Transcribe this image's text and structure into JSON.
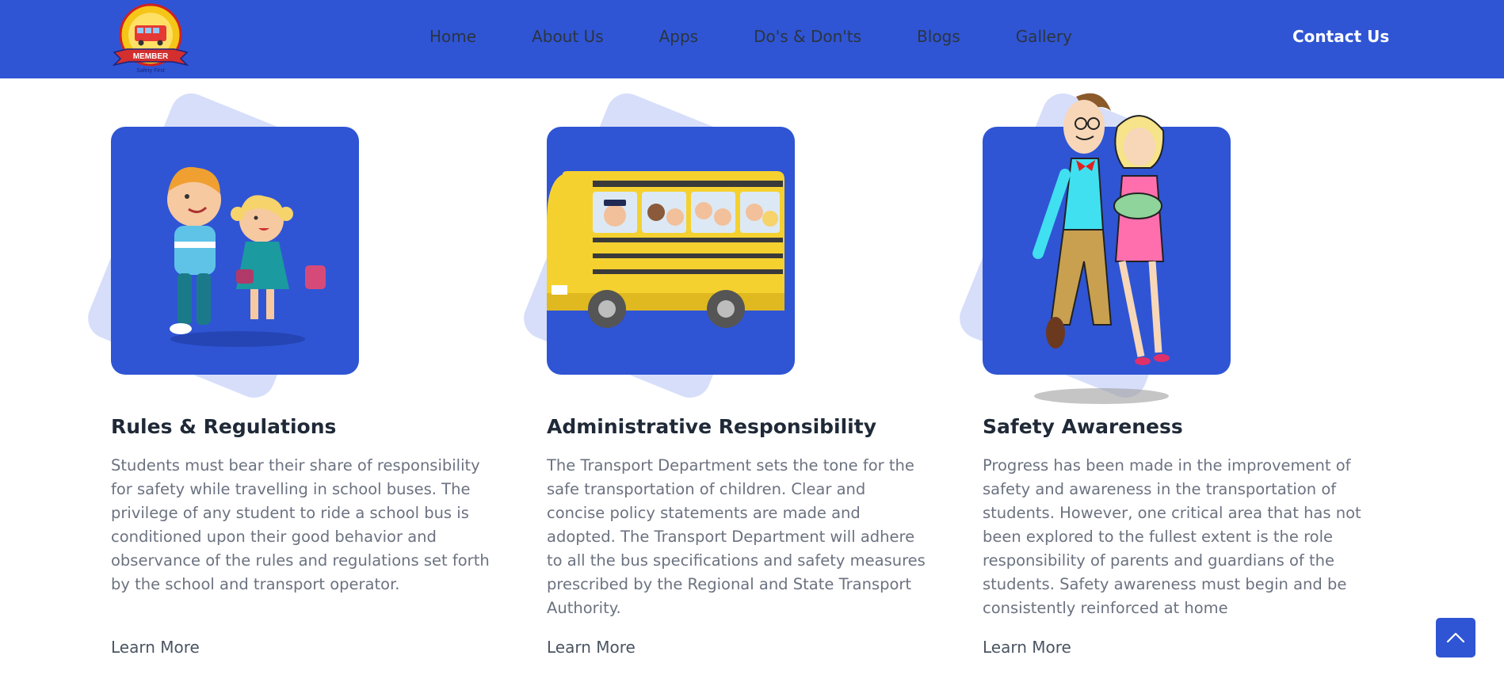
{
  "nav": {
    "items": [
      {
        "label": "Home"
      },
      {
        "label": "About Us"
      },
      {
        "label": "Apps"
      },
      {
        "label": "Do's & Don'ts"
      },
      {
        "label": "Blogs"
      },
      {
        "label": "Gallery"
      }
    ],
    "contact_label": "Contact Us"
  },
  "logo": {
    "badge_text": "MEMBER",
    "tagline": "Safety First"
  },
  "cards": [
    {
      "title": "Rules & Regulations",
      "text": "Students must bear their share of responsibility for safety while travelling in school buses. The privilege of any student to ride a school bus is conditioned upon their good behavior and observance of the rules and regulations set forth by the school and transport operator.",
      "link": "Learn More"
    },
    {
      "title": "Administrative Responsibility",
      "text": "The Transport Department sets the tone for the safe transportation of children. Clear and concise policy statements are made and adopted. The Transport Department will adhere to all the bus specifications and safety measures prescribed by the Regional and State Transport Authority.",
      "link": "Learn More"
    },
    {
      "title": "Safety Awareness",
      "text": "Progress has been made in the improvement of safety and awareness in the transportation of students. However, one critical area that has not been explored to the fullest extent is the role responsibility of parents and guardians of the students. Safety awareness must begin and be consistently reinforced at home",
      "link": "Learn More"
    }
  ],
  "icons": {
    "scroll_top": "chevron-up-icon",
    "logo": "school-bus-logo-icon"
  },
  "colors": {
    "brand": "#2f55d4",
    "deco": "#d6defa",
    "title": "#1f2937",
    "text": "#6b7280"
  }
}
